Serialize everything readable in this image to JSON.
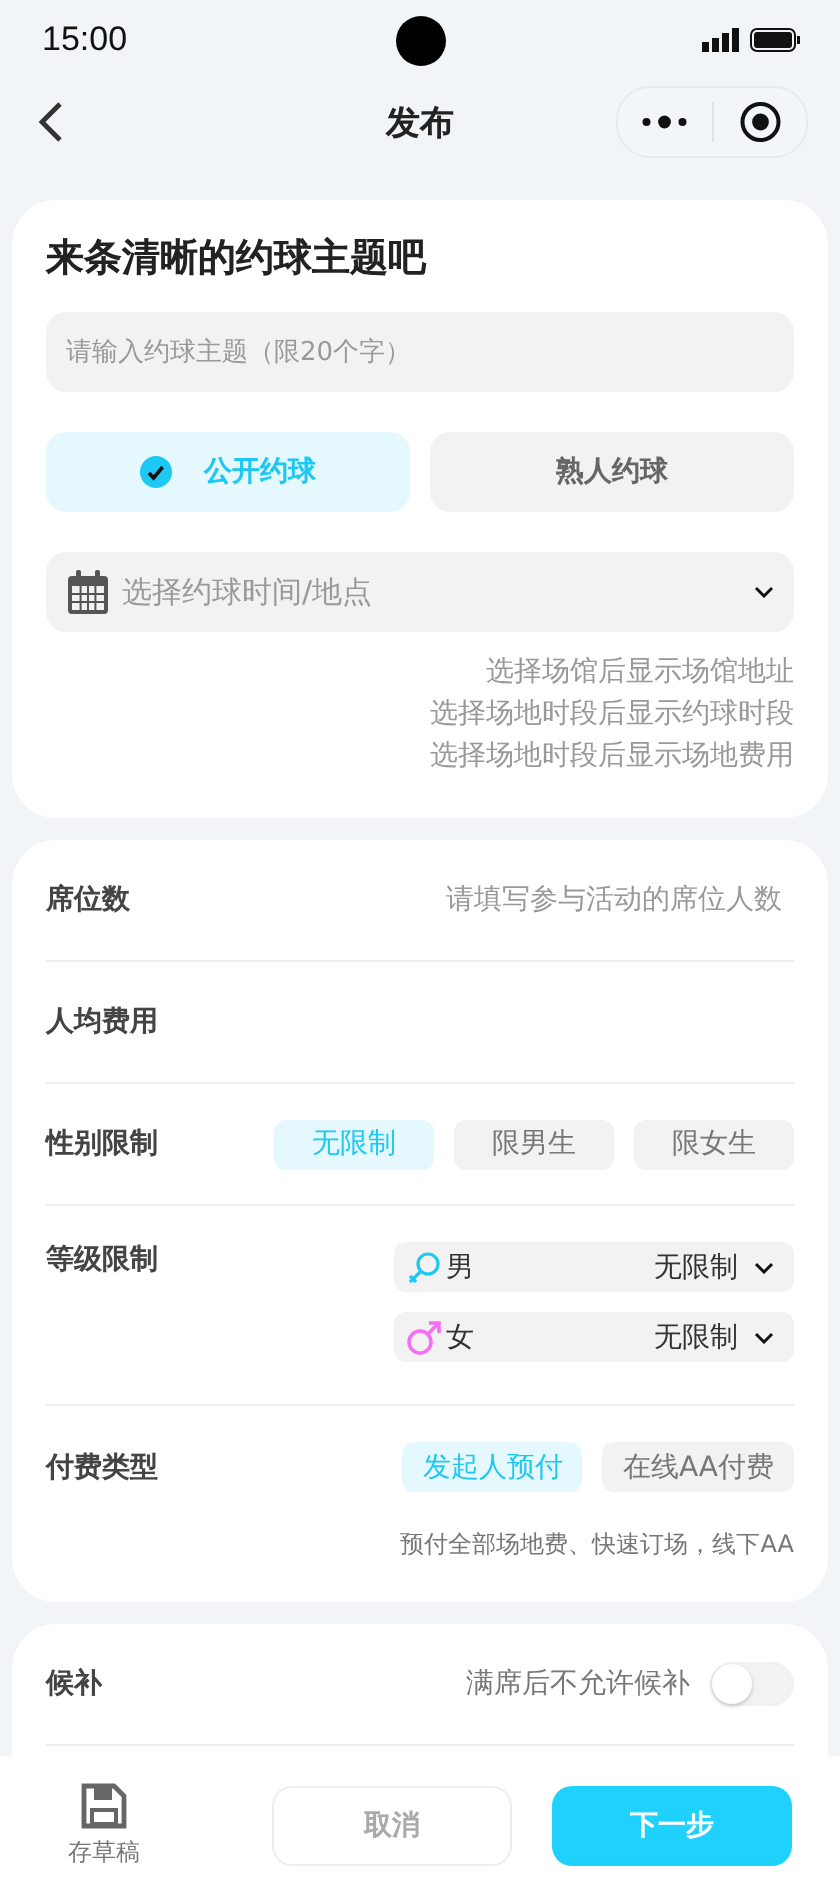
{
  "status_bar": {
    "time": "15:00"
  },
  "nav": {
    "title": "发布"
  },
  "topic": {
    "title": "来条清晰的约球主题吧",
    "placeholder": "请输入约球主题（限20个字）"
  },
  "visibility_options": [
    {
      "label": "公开约球",
      "selected": true
    },
    {
      "label": "熟人约球",
      "selected": false
    }
  ],
  "schedule_select": {
    "placeholder": "选择约球时间/地点"
  },
  "hints": [
    "选择场馆后显示场馆地址",
    "选择场地时段后显示约球时段",
    "选择场地时段后显示场地费用"
  ],
  "seats": {
    "label": "席位数",
    "placeholder": "请填写参与活动的席位人数"
  },
  "cost": {
    "label": "人均费用"
  },
  "gender_limit": {
    "label": "性别限制",
    "options": [
      {
        "label": "无限制",
        "selected": true
      },
      {
        "label": "限男生",
        "selected": false
      },
      {
        "label": "限女生",
        "selected": false
      }
    ]
  },
  "level_limit": {
    "label": "等级限制",
    "selects": [
      {
        "kind": "male",
        "label": "男",
        "value": "无限制"
      },
      {
        "kind": "female",
        "label": "女",
        "value": "无限制"
      }
    ]
  },
  "payment_type": {
    "label": "付费类型",
    "options": [
      {
        "label": "发起人预付",
        "selected": true
      },
      {
        "label": "在线AA付费",
        "selected": false
      }
    ],
    "note": "预付全部场地费、快速订场，线下AA"
  },
  "waitlist": {
    "label": "候补",
    "text": "满席后不允许候补",
    "on": false
  },
  "footer": {
    "draft": "存草稿",
    "cancel": "取消",
    "next": "下一步"
  }
}
